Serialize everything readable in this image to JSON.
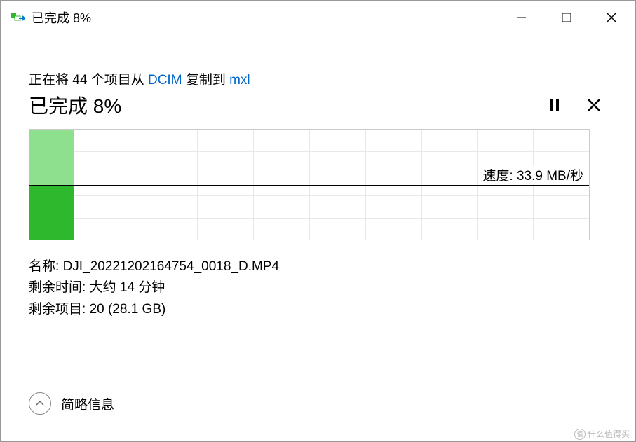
{
  "titlebar": {
    "title": "已完成 8%"
  },
  "copy": {
    "prefix": "正在将 44 个项目从 ",
    "source": "DCIM",
    "mid": " 复制到 ",
    "dest": "mxl"
  },
  "progress": {
    "title": "已完成 8%"
  },
  "chart": {
    "speed_label": "速度: 33.9 MB/秒"
  },
  "details": {
    "name_label": "名称: ",
    "name_value": "DJI_20221202164754_0018_D.MP4",
    "time_label": "剩余时间: ",
    "time_value": "大约 14 分钟",
    "items_label": "剩余项目: ",
    "items_value": "20 (28.1 GB)"
  },
  "footer": {
    "label": "简略信息"
  },
  "watermark": {
    "text": "什么值得买"
  },
  "chart_data": {
    "type": "area",
    "title": "",
    "xlabel": "",
    "ylabel": "",
    "progress_percent": 8,
    "current_speed_mb_s": 33.9,
    "peak_speed_mb_s": 68,
    "ylim": [
      0,
      68
    ],
    "series": [
      {
        "name": "peak_speed",
        "values_approx_mb_s": [
          68,
          68,
          68,
          68,
          68,
          68,
          68,
          68
        ]
      },
      {
        "name": "current_speed",
        "values_approx_mb_s": [
          34,
          33,
          34,
          34,
          33,
          34,
          34,
          33.9
        ]
      }
    ]
  }
}
